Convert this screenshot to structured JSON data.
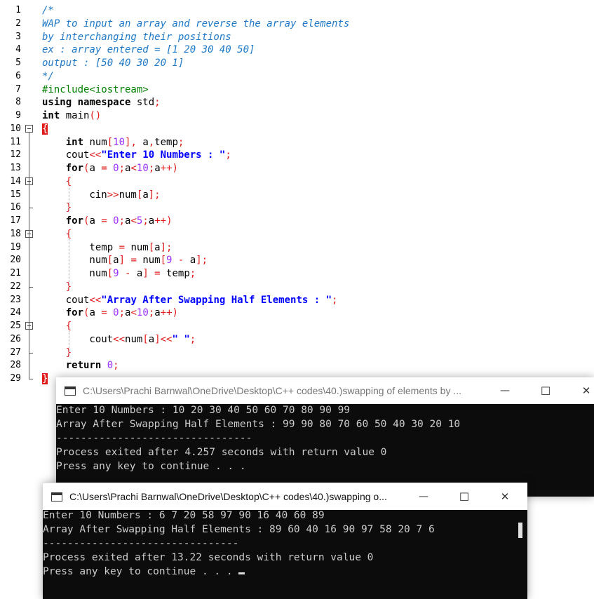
{
  "editor": {
    "lines": [
      {
        "n": "1",
        "s": [
          {
            "t": "/*",
            "c": "cm"
          }
        ]
      },
      {
        "n": "2",
        "s": [
          {
            "t": "WAP to input an array and reverse the array elements",
            "c": "cm"
          }
        ]
      },
      {
        "n": "3",
        "s": [
          {
            "t": "by interchanging their positions",
            "c": "cm"
          }
        ]
      },
      {
        "n": "4",
        "s": [
          {
            "t": "ex : array entered = [1 20 30 40 50]",
            "c": "cm"
          }
        ]
      },
      {
        "n": "5",
        "s": [
          {
            "t": "output : [50 40 30 20 1]",
            "c": "cm"
          }
        ]
      },
      {
        "n": "6",
        "s": [
          {
            "t": "*/",
            "c": "cm"
          }
        ]
      },
      {
        "n": "7",
        "s": [
          {
            "t": "#include<iostream>",
            "c": "pp"
          }
        ]
      },
      {
        "n": "8",
        "s": [
          {
            "t": "using namespace ",
            "c": "kw"
          },
          {
            "t": "std",
            "c": ""
          },
          {
            "t": ";",
            "c": "sy"
          }
        ]
      },
      {
        "n": "9",
        "s": [
          {
            "t": "int ",
            "c": "kw"
          },
          {
            "t": "main",
            "c": ""
          },
          {
            "t": "()",
            "c": "sy"
          }
        ]
      },
      {
        "n": "10",
        "s": [
          {
            "t": "{",
            "c": "brmark"
          }
        ]
      },
      {
        "n": "11",
        "s": [
          {
            "t": "    ",
            "c": ""
          },
          {
            "t": "int ",
            "c": "kw"
          },
          {
            "t": "num",
            "c": ""
          },
          {
            "t": "[",
            "c": "sy"
          },
          {
            "t": "10",
            "c": "nm"
          },
          {
            "t": "], ",
            "c": "sy"
          },
          {
            "t": "a",
            "c": ""
          },
          {
            "t": ",",
            "c": "sy"
          },
          {
            "t": "temp",
            "c": ""
          },
          {
            "t": ";",
            "c": "sy"
          }
        ]
      },
      {
        "n": "12",
        "s": [
          {
            "t": "    cout",
            "c": ""
          },
          {
            "t": "<<",
            "c": "sy"
          },
          {
            "t": "\"Enter 10 Numbers : \"",
            "c": "st"
          },
          {
            "t": ";",
            "c": "sy"
          }
        ]
      },
      {
        "n": "13",
        "s": [
          {
            "t": "    ",
            "c": ""
          },
          {
            "t": "for",
            "c": "kw"
          },
          {
            "t": "(",
            "c": "sy"
          },
          {
            "t": "a ",
            "c": ""
          },
          {
            "t": "= ",
            "c": "sy"
          },
          {
            "t": "0",
            "c": "nm"
          },
          {
            "t": ";",
            "c": "sy"
          },
          {
            "t": "a",
            "c": ""
          },
          {
            "t": "<",
            "c": "sy"
          },
          {
            "t": "10",
            "c": "nm"
          },
          {
            "t": ";",
            "c": "sy"
          },
          {
            "t": "a",
            "c": ""
          },
          {
            "t": "++)",
            "c": "sy"
          }
        ]
      },
      {
        "n": "14",
        "s": [
          {
            "t": "    ",
            "c": ""
          },
          {
            "t": "{",
            "c": "sy"
          }
        ]
      },
      {
        "n": "15",
        "s": [
          {
            "t": "        cin",
            "c": ""
          },
          {
            "t": ">>",
            "c": "sy"
          },
          {
            "t": "num",
            "c": ""
          },
          {
            "t": "[",
            "c": "sy"
          },
          {
            "t": "a",
            "c": ""
          },
          {
            "t": "];",
            "c": "sy"
          }
        ]
      },
      {
        "n": "16",
        "s": [
          {
            "t": "    ",
            "c": ""
          },
          {
            "t": "}",
            "c": "sy"
          }
        ]
      },
      {
        "n": "17",
        "s": [
          {
            "t": "    ",
            "c": ""
          },
          {
            "t": "for",
            "c": "kw"
          },
          {
            "t": "(",
            "c": "sy"
          },
          {
            "t": "a ",
            "c": ""
          },
          {
            "t": "= ",
            "c": "sy"
          },
          {
            "t": "0",
            "c": "nm"
          },
          {
            "t": ";",
            "c": "sy"
          },
          {
            "t": "a",
            "c": ""
          },
          {
            "t": "<",
            "c": "sy"
          },
          {
            "t": "5",
            "c": "nm"
          },
          {
            "t": ";",
            "c": "sy"
          },
          {
            "t": "a",
            "c": ""
          },
          {
            "t": "++)",
            "c": "sy"
          }
        ]
      },
      {
        "n": "18",
        "s": [
          {
            "t": "    ",
            "c": ""
          },
          {
            "t": "{",
            "c": "sy"
          }
        ]
      },
      {
        "n": "19",
        "s": [
          {
            "t": "        temp ",
            "c": ""
          },
          {
            "t": "= ",
            "c": "sy"
          },
          {
            "t": "num",
            "c": ""
          },
          {
            "t": "[",
            "c": "sy"
          },
          {
            "t": "a",
            "c": ""
          },
          {
            "t": "];",
            "c": "sy"
          }
        ]
      },
      {
        "n": "20",
        "s": [
          {
            "t": "        num",
            "c": ""
          },
          {
            "t": "[",
            "c": "sy"
          },
          {
            "t": "a",
            "c": ""
          },
          {
            "t": "] = ",
            "c": "sy"
          },
          {
            "t": "num",
            "c": ""
          },
          {
            "t": "[",
            "c": "sy"
          },
          {
            "t": "9",
            "c": "nm"
          },
          {
            "t": " - ",
            "c": "sy"
          },
          {
            "t": "a",
            "c": ""
          },
          {
            "t": "];",
            "c": "sy"
          }
        ]
      },
      {
        "n": "21",
        "s": [
          {
            "t": "        num",
            "c": ""
          },
          {
            "t": "[",
            "c": "sy"
          },
          {
            "t": "9",
            "c": "nm"
          },
          {
            "t": " - ",
            "c": "sy"
          },
          {
            "t": "a",
            "c": ""
          },
          {
            "t": "] = ",
            "c": "sy"
          },
          {
            "t": "temp",
            "c": ""
          },
          {
            "t": ";",
            "c": "sy"
          }
        ]
      },
      {
        "n": "22",
        "s": [
          {
            "t": "    ",
            "c": ""
          },
          {
            "t": "}",
            "c": "sy"
          }
        ]
      },
      {
        "n": "23",
        "s": [
          {
            "t": "    cout",
            "c": ""
          },
          {
            "t": "<<",
            "c": "sy"
          },
          {
            "t": "\"Array After Swapping Half Elements : \"",
            "c": "st"
          },
          {
            "t": ";",
            "c": "sy"
          }
        ]
      },
      {
        "n": "24",
        "s": [
          {
            "t": "    ",
            "c": ""
          },
          {
            "t": "for",
            "c": "kw"
          },
          {
            "t": "(",
            "c": "sy"
          },
          {
            "t": "a ",
            "c": ""
          },
          {
            "t": "= ",
            "c": "sy"
          },
          {
            "t": "0",
            "c": "nm"
          },
          {
            "t": ";",
            "c": "sy"
          },
          {
            "t": "a",
            "c": ""
          },
          {
            "t": "<",
            "c": "sy"
          },
          {
            "t": "10",
            "c": "nm"
          },
          {
            "t": ";",
            "c": "sy"
          },
          {
            "t": "a",
            "c": ""
          },
          {
            "t": "++)",
            "c": "sy"
          }
        ]
      },
      {
        "n": "25",
        "s": [
          {
            "t": "    ",
            "c": ""
          },
          {
            "t": "{",
            "c": "sy"
          }
        ]
      },
      {
        "n": "26",
        "s": [
          {
            "t": "        cout",
            "c": ""
          },
          {
            "t": "<<",
            "c": "sy"
          },
          {
            "t": "num",
            "c": ""
          },
          {
            "t": "[",
            "c": "sy"
          },
          {
            "t": "a",
            "c": ""
          },
          {
            "t": "]<<",
            "c": "sy"
          },
          {
            "t": "\" \"",
            "c": "st"
          },
          {
            "t": ";",
            "c": "sy"
          }
        ]
      },
      {
        "n": "27",
        "s": [
          {
            "t": "    ",
            "c": ""
          },
          {
            "t": "}",
            "c": "sy"
          }
        ]
      },
      {
        "n": "28",
        "s": [
          {
            "t": "    ",
            "c": ""
          },
          {
            "t": "return ",
            "c": "kw"
          },
          {
            "t": "0",
            "c": "nm"
          },
          {
            "t": ";",
            "c": "sy"
          }
        ]
      },
      {
        "n": "29",
        "s": [
          {
            "t": "}",
            "c": "brmark"
          }
        ]
      }
    ]
  },
  "console1": {
    "title": "C:\\Users\\Prachi Barnwal\\OneDrive\\Desktop\\C++ codes\\40.)swapping of elements by ...",
    "lines": [
      "Enter 10 Numbers : 10 20 30 40 50 60 70 80 90 99",
      "Array After Swapping Half Elements : 99 90 80 70 60 50 40 30 20 10",
      "--------------------------------",
      "Process exited after 4.257 seconds with return value 0",
      "Press any key to continue . . ."
    ]
  },
  "console2": {
    "title": "C:\\Users\\Prachi Barnwal\\OneDrive\\Desktop\\C++ codes\\40.)swapping o...",
    "lines": [
      "Enter 10 Numbers : 6 7 20 58 97 90 16 40 60 89",
      "Array After Swapping Half Elements : 89 60 40 16 90 97 58 20 7 6",
      "--------------------------------",
      "Process exited after 13.22 seconds with return value 0",
      "Press any key to continue . . ."
    ]
  },
  "window_controls": {
    "minimize": "—",
    "maximize": "☐",
    "close": "✕"
  },
  "icons": {
    "console_icon": "terminal-icon"
  },
  "colors": {
    "comment": "#1e79c8",
    "preprocessor": "#008000",
    "symbol": "#e01b1b",
    "string": "#0000ff",
    "number": "#9b30ff",
    "console_bg": "#0c0c0c",
    "console_text": "#cccccc"
  }
}
